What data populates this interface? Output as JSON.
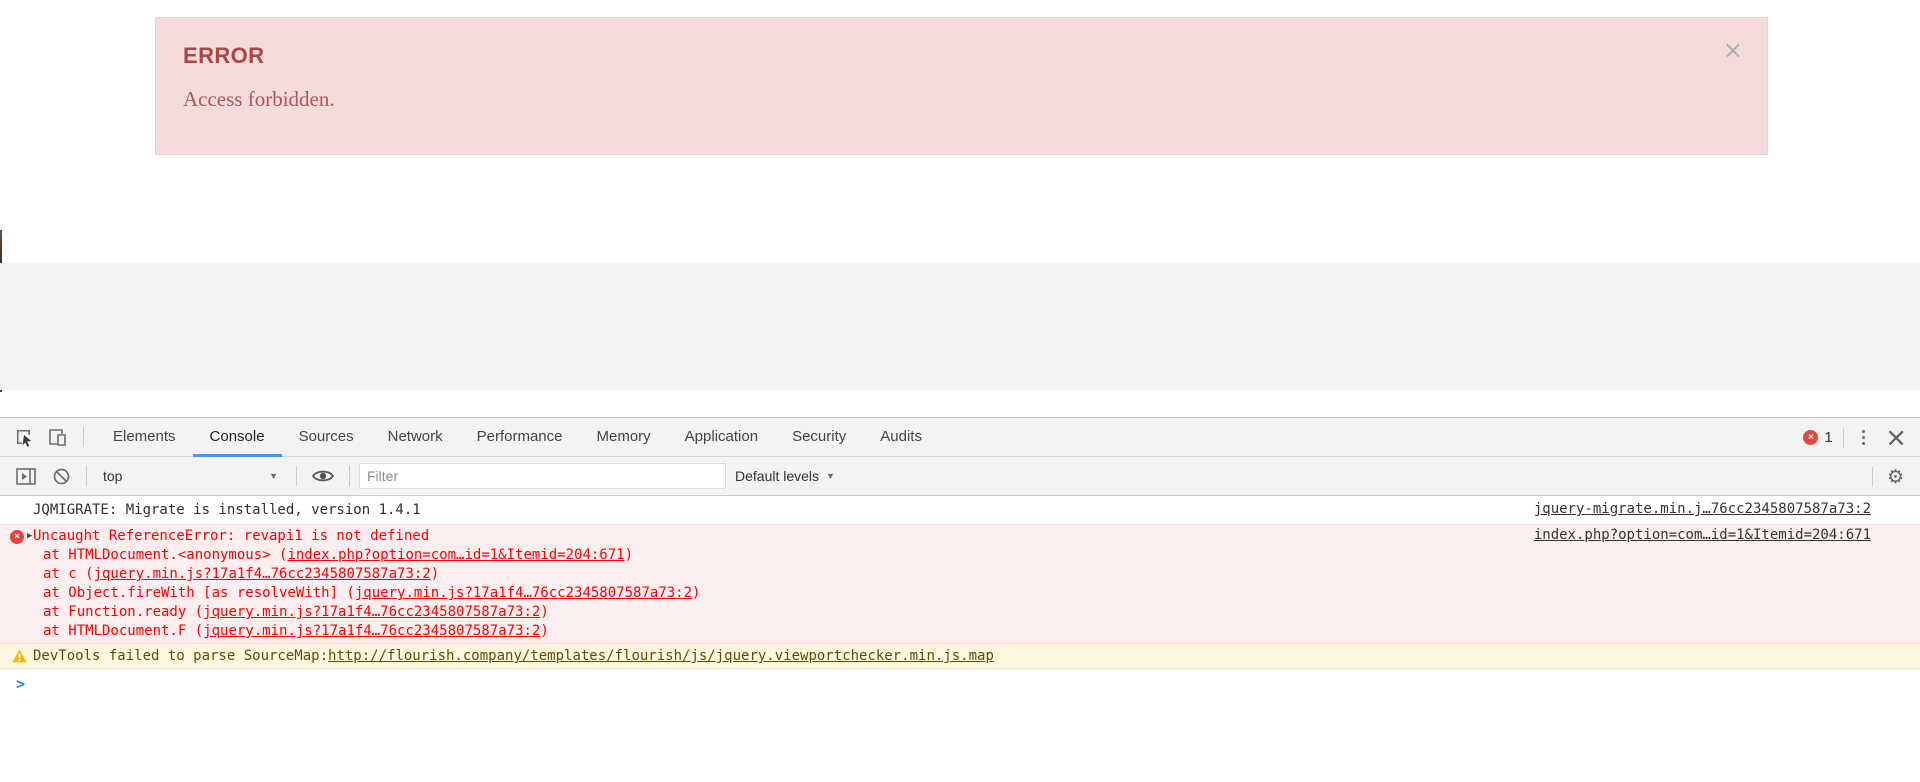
{
  "alert": {
    "title": "ERROR",
    "message": "Access forbidden.",
    "close_glyph": "×"
  },
  "devtools": {
    "tabs": [
      "Elements",
      "Console",
      "Sources",
      "Network",
      "Performance",
      "Memory",
      "Application",
      "Security",
      "Audits"
    ],
    "active_tab": "Console",
    "error_badge_count": "1",
    "badge_glyph": "×",
    "close_glyph": "×",
    "toolbar": {
      "context_selector": "top",
      "filter_placeholder": "Filter",
      "levels_selector": "Default levels",
      "dropdown_glyph": "▼",
      "settings_glyph": "⚙"
    },
    "console": {
      "info": {
        "text": "JQMIGRATE: Migrate is installed, version 1.4.1",
        "source_link": "jquery-migrate.min.j…76cc2345807587a73:2"
      },
      "error": {
        "expand_glyph": "▶",
        "text": "Uncaught ReferenceError: revapi1 is not defined",
        "source_link": "index.php?option=com…id=1&Itemid=204:671",
        "stack": [
          {
            "pre": "at HTMLDocument.<anonymous> (",
            "link": "index.php?option=com…id=1&Itemid=204:671",
            "post": ")"
          },
          {
            "pre": "at c (",
            "link": "jquery.min.js?17a1f4…76cc2345807587a73:2",
            "post": ")"
          },
          {
            "pre": "at Object.fireWith [as resolveWith] (",
            "link": "jquery.min.js?17a1f4…76cc2345807587a73:2",
            "post": ")"
          },
          {
            "pre": "at Function.ready (",
            "link": "jquery.min.js?17a1f4…76cc2345807587a73:2",
            "post": ")"
          },
          {
            "pre": "at HTMLDocument.F (",
            "link": "jquery.min.js?17a1f4…76cc2345807587a73:2",
            "post": ")"
          }
        ]
      },
      "warning": {
        "text": "DevTools failed to parse SourceMap: ",
        "link": "http://flourish.company/templates/flourish/js/jquery.viewportchecker.min.js.map"
      },
      "prompt_glyph": ">"
    }
  },
  "colors": {
    "accent_blue": "#3b99fc",
    "error_red": "#fe0000",
    "error_badge": "#e8453c",
    "error_bg": "#fdefef",
    "warning_bg": "#fcf6de",
    "warning_text": "#5e4e05",
    "alert_bg": "#f4dcdc",
    "alert_text": "#ae4543"
  }
}
